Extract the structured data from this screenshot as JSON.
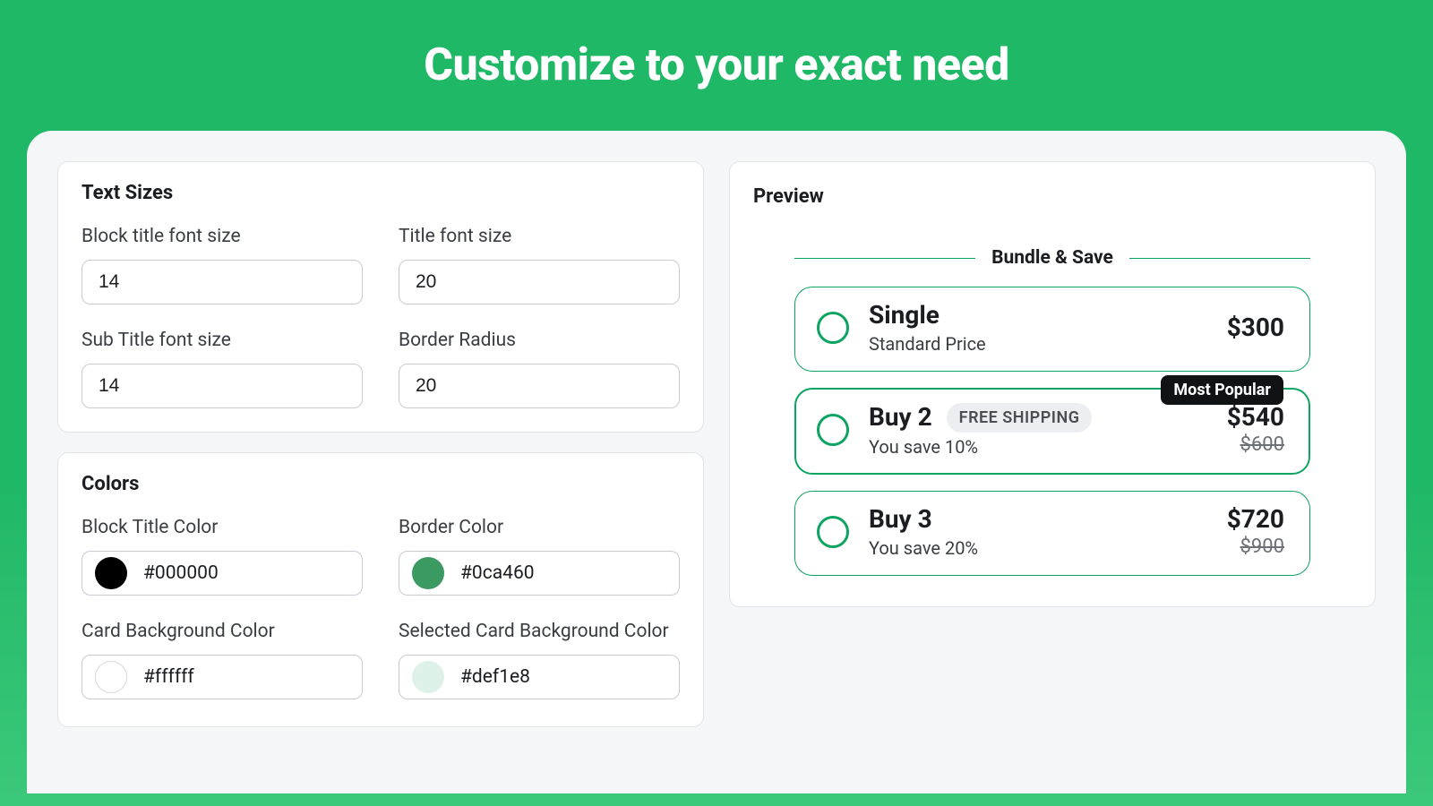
{
  "page": {
    "title": "Customize to your exact need"
  },
  "sections": {
    "text_sizes": {
      "heading": "Text Sizes",
      "fields": {
        "block_title_font_size": {
          "label": "Block title font size",
          "value": "14"
        },
        "title_font_size": {
          "label": "Title font size",
          "value": "20"
        },
        "sub_title_font_size": {
          "label": "Sub Title font size",
          "value": "14"
        },
        "border_radius": {
          "label": "Border Radius",
          "value": "20"
        }
      }
    },
    "colors": {
      "heading": "Colors",
      "fields": {
        "block_title_color": {
          "label": "Block Title Color",
          "value": "#000000"
        },
        "border_color": {
          "label": "Border Color",
          "value": "#0ca460"
        },
        "card_bg_color": {
          "label": "Card Background Color",
          "value": "#ffffff"
        },
        "selected_card_bg_color": {
          "label": "Selected Card Background Color",
          "value": "#def1e8"
        }
      }
    }
  },
  "preview": {
    "heading": "Preview",
    "bundle_title": "Bundle & Save",
    "popular_badge": "Most Popular",
    "items": [
      {
        "name": "Single",
        "sub": "Standard Price",
        "chip": "",
        "price": "$300",
        "old_price": "",
        "selected": false
      },
      {
        "name": "Buy 2",
        "sub": "You save 10%",
        "chip": "FREE SHIPPING",
        "price": "$540",
        "old_price": "$600",
        "selected": true
      },
      {
        "name": "Buy 3",
        "sub": "You save 20%",
        "chip": "",
        "price": "$720",
        "old_price": "$900",
        "selected": false
      }
    ]
  },
  "colors_palette": {
    "block_title_swatch": "#000000",
    "border_swatch": "#3a9a61",
    "card_bg_swatch": "#ffffff",
    "selected_card_bg_swatch": "#def1e8"
  }
}
